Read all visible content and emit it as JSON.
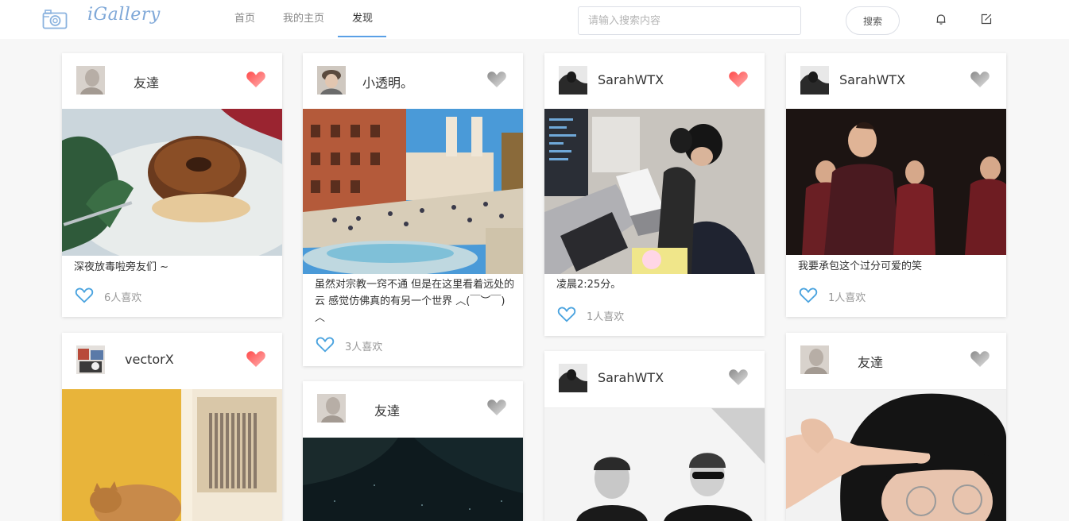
{
  "header": {
    "logo_text": "iGallery",
    "nav": [
      "首页",
      "我的主页",
      "发现"
    ],
    "search_placeholder": "请输入搜索内容",
    "search_button": "搜索"
  },
  "colors": {
    "accent": "#5aa0e6",
    "like_blue": "#4aa3df",
    "fav_red": "#f56c6c",
    "fav_gray": "#b0b0b0"
  },
  "cards": [
    {
      "user": "友達",
      "favorited": true,
      "desc": "深夜放毒啦旁友们 ~",
      "likes": "6人喜欢"
    },
    {
      "user": "小透明。",
      "favorited": false,
      "desc": "虽然对宗教一窍不通 但是在这里看着远处的云 感觉仿佛真的有另一个世界 ︿(￣︶￣)︿",
      "likes": "3人喜欢"
    },
    {
      "user": "SarahWTX",
      "favorited": true,
      "desc": "凌晨2:25分。",
      "likes": "1人喜欢"
    },
    {
      "user": "SarahWTX",
      "favorited": false,
      "desc": "我要承包这个过分可爱的笑",
      "likes": "1人喜欢"
    },
    {
      "user": "vectorX",
      "favorited": true
    },
    {
      "user": "友達",
      "favorited": false
    },
    {
      "user": "SarahWTX",
      "favorited": false
    },
    {
      "user": "友達",
      "favorited": false
    }
  ]
}
